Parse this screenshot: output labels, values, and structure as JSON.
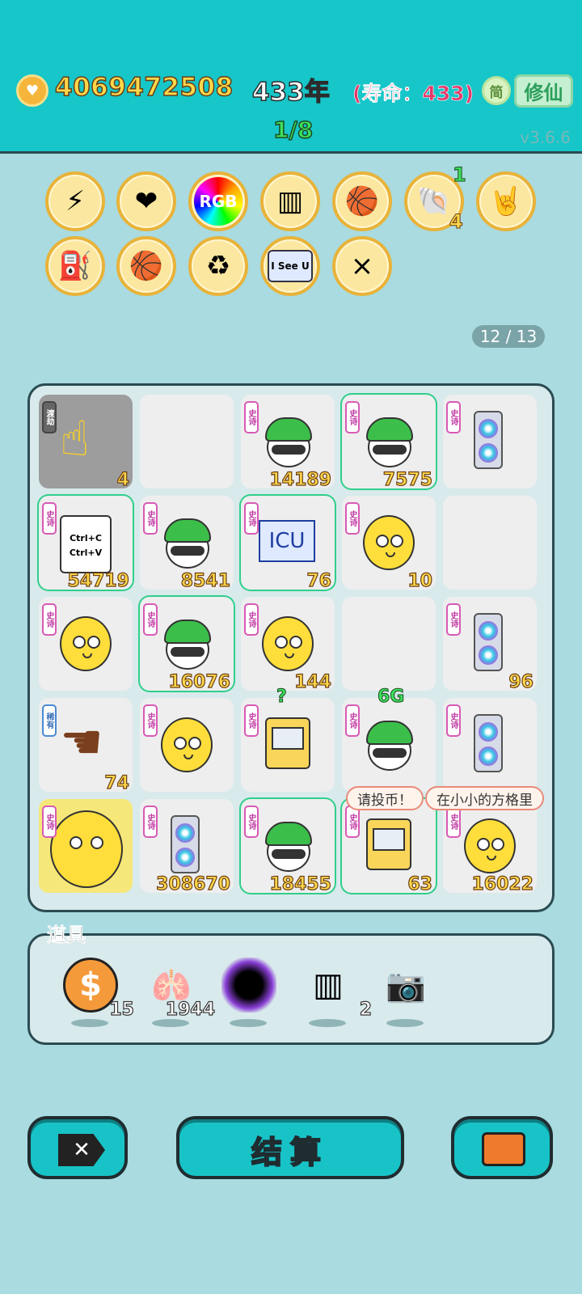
{
  "header": {
    "money": "4069472508",
    "year": "433年",
    "life": "(寿命：433)",
    "simp_label": "简",
    "xiu_label": "修仙",
    "round": "1/8",
    "version": "v3.6.6"
  },
  "badges": [
    {
      "name": "lightning-badge",
      "icon": "⚡"
    },
    {
      "name": "heart-fan-badge",
      "icon": "❤"
    },
    {
      "name": "rgb-badge",
      "icon": "RGB"
    },
    {
      "name": "skirt-badge",
      "icon": "▥"
    },
    {
      "name": "basketballs-badge",
      "icon": "🏀"
    },
    {
      "name": "shell-badge",
      "icon": "🐚",
      "top_count": "1",
      "bottom_count": "4"
    },
    {
      "name": "rock-hand-badge",
      "icon": "🤘"
    },
    {
      "name": "pump-badge",
      "icon": "⛽"
    },
    {
      "name": "basketballs-badge-2",
      "icon": "🏀"
    },
    {
      "name": "recycle-badge",
      "icon": "♻"
    },
    {
      "name": "i-see-u-badge",
      "icon": "I See U"
    },
    {
      "name": "multiply-badge",
      "icon": "×"
    }
  ],
  "slot_count": "12 / 13",
  "board": {
    "tags": {
      "epic": "史诗",
      "transcend": "渡劫",
      "rare": "稀有"
    },
    "cells": [
      {
        "kind": "hand-yellow",
        "tag": "transcend",
        "num": "4",
        "bg": "gray"
      },
      {
        "kind": "empty"
      },
      {
        "kind": "green-head",
        "tag": "epic",
        "num": "14189"
      },
      {
        "kind": "green-head",
        "tag": "epic",
        "num": "7575",
        "highlight": true
      },
      {
        "kind": "gpu",
        "tag": "epic",
        "num": ""
      },
      {
        "kind": "ctrl-card",
        "tag": "epic",
        "num": "54719",
        "highlight": true,
        "text1": "Ctrl+C",
        "text2": "Ctrl+V"
      },
      {
        "kind": "green-head",
        "tag": "epic",
        "num": "8541"
      },
      {
        "kind": "icu",
        "tag": "epic",
        "num": "76",
        "highlight": true,
        "text": "ICU"
      },
      {
        "kind": "yellow-face",
        "tag": "epic",
        "num": "10"
      },
      {
        "kind": "empty"
      },
      {
        "kind": "yellow-face",
        "tag": "epic",
        "num": ""
      },
      {
        "kind": "green-head",
        "tag": "epic",
        "num": "16076",
        "highlight": true
      },
      {
        "kind": "yellow-face",
        "tag": "epic",
        "num": "144"
      },
      {
        "kind": "empty"
      },
      {
        "kind": "gpu",
        "tag": "epic",
        "num": "96"
      },
      {
        "kind": "brown-hand",
        "tag": "rare",
        "num": "74"
      },
      {
        "kind": "yellow-face",
        "tag": "epic",
        "num": ""
      },
      {
        "kind": "claw-machine",
        "tag": "epic",
        "num": "",
        "top": "?"
      },
      {
        "kind": "green-head",
        "tag": "epic",
        "num": "",
        "top": "6G"
      },
      {
        "kind": "gpu",
        "tag": "epic",
        "num": ""
      },
      {
        "kind": "big-yellow-face",
        "tag": "epic",
        "num": "",
        "bg": "yellow"
      },
      {
        "kind": "gpu",
        "tag": "epic",
        "num": "308670"
      },
      {
        "kind": "green-head",
        "tag": "epic",
        "num": "18455",
        "highlight": true
      },
      {
        "kind": "claw-machine",
        "tag": "epic",
        "num": "63",
        "highlight": true
      },
      {
        "kind": "yellow-face",
        "tag": "epic",
        "num": "16022"
      }
    ],
    "bubbles": [
      "请投币！",
      "在小小的方格里"
    ]
  },
  "items": {
    "title": "道具",
    "list": [
      {
        "name": "coin-item",
        "icon": "$",
        "count": "15"
      },
      {
        "name": "liver-item",
        "icon": "🫁",
        "count": "1944"
      },
      {
        "name": "black-hole-item",
        "icon": "●",
        "count": ""
      },
      {
        "name": "cage-item",
        "icon": "▥",
        "count": "2"
      },
      {
        "name": "camera-item",
        "icon": "📷",
        "count": ""
      }
    ]
  },
  "buttons": {
    "settle": "结算"
  },
  "colors": {
    "topbar": "#16c6c9",
    "background": "#a9dbe0",
    "gold_number": "#ffd84a",
    "green_round": "#3ee05c",
    "life_red": "#e43a6a"
  }
}
